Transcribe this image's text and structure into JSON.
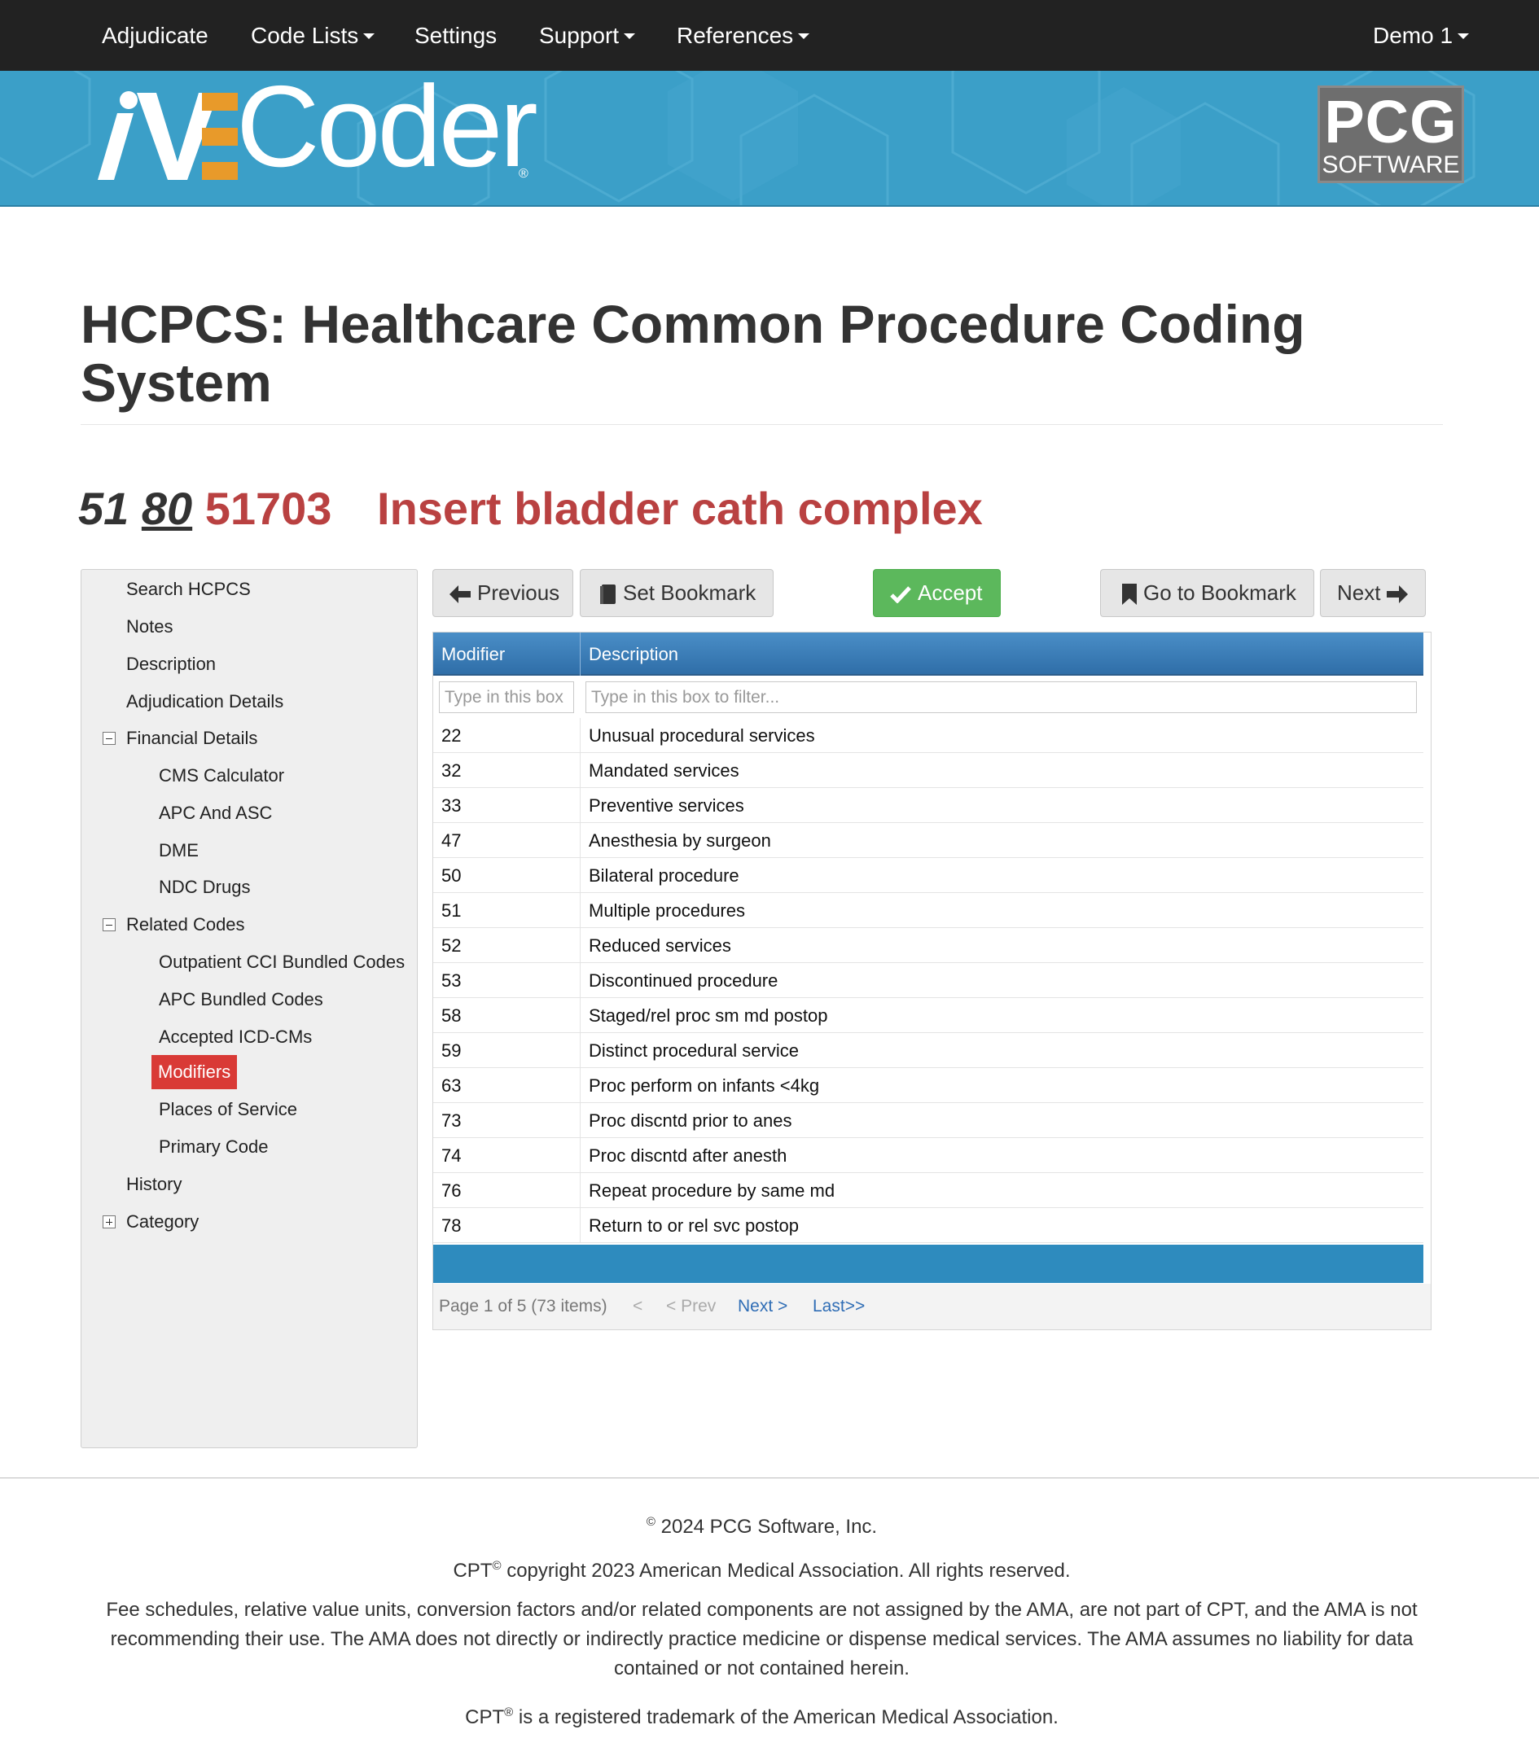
{
  "nav": {
    "adjudicate": "Adjudicate",
    "code_lists": "Code Lists",
    "settings": "Settings",
    "support": "Support",
    "references": "References",
    "user": "Demo 1"
  },
  "brand": {
    "logo_text": "Coder",
    "logo_prefix": "iVE",
    "registered": "®",
    "vendor_top": "PCG",
    "vendor_bottom": "SOFTWARE",
    "accent_color": "#e89a2a",
    "banner_color": "#3b9fc8"
  },
  "page": {
    "title": "HCPCS: Healthcare Common Procedure Coding System",
    "modifier_a": "51",
    "modifier_b": "80",
    "code": "51703",
    "code_description": "Insert bladder cath complex"
  },
  "sidebar": {
    "items": [
      {
        "label": "Search HCPCS"
      },
      {
        "label": "Notes"
      },
      {
        "label": "Description"
      },
      {
        "label": "Adjudication Details"
      },
      {
        "label": "Financial Details"
      },
      {
        "label": "CMS Calculator"
      },
      {
        "label": "APC And ASC"
      },
      {
        "label": "DME"
      },
      {
        "label": "NDC Drugs"
      },
      {
        "label": "Related Codes"
      },
      {
        "label": "Outpatient CCI Bundled Codes"
      },
      {
        "label": "APC Bundled Codes"
      },
      {
        "label": "Accepted ICD-CMs"
      },
      {
        "label": "Modifiers"
      },
      {
        "label": "Places of Service"
      },
      {
        "label": "Primary Code"
      },
      {
        "label": "History"
      },
      {
        "label": "Category"
      }
    ]
  },
  "toolbar": {
    "previous": "Previous",
    "set_bookmark": "Set Bookmark",
    "accept": "Accept",
    "go_to_bookmark": "Go to Bookmark",
    "next": "Next"
  },
  "grid": {
    "columns": [
      "Modifier",
      "Description"
    ],
    "filter_modifier_placeholder": "Type in this box",
    "filter_description_placeholder": "Type in this box to filter...",
    "rows": [
      {
        "modifier": "22",
        "description": "Unusual procedural services"
      },
      {
        "modifier": "32",
        "description": "Mandated services"
      },
      {
        "modifier": "33",
        "description": "Preventive services"
      },
      {
        "modifier": "47",
        "description": "Anesthesia by surgeon"
      },
      {
        "modifier": "50",
        "description": "Bilateral procedure"
      },
      {
        "modifier": "51",
        "description": "Multiple procedures"
      },
      {
        "modifier": "52",
        "description": "Reduced services"
      },
      {
        "modifier": "53",
        "description": "Discontinued procedure"
      },
      {
        "modifier": "58",
        "description": "Staged/rel proc sm md postop"
      },
      {
        "modifier": "59",
        "description": "Distinct procedural service"
      },
      {
        "modifier": "63",
        "description": "Proc perform on infants <4kg"
      },
      {
        "modifier": "73",
        "description": "Proc discntd prior to anes"
      },
      {
        "modifier": "74",
        "description": "Proc discntd after anesth"
      },
      {
        "modifier": "76",
        "description": "Repeat procedure by same md"
      },
      {
        "modifier": "78",
        "description": "Return to or rel svc postop"
      }
    ],
    "pager": {
      "status": "Page 1 of 5 (73 items)",
      "first": "<",
      "prev": "< Prev",
      "next": "Next >",
      "last": "Last>>"
    }
  },
  "footer": {
    "copyright_symbol": "©",
    "copyright": "2024 PCG Software, Inc.",
    "cpt_prefix": "CPT",
    "cpt_copyright_symbol": "©",
    "cpt_copyright": "copyright 2023 American Medical Association. All rights reserved.",
    "disclaimer": "Fee schedules, relative value units, conversion factors and/or related components are not assigned by the AMA, are not part of CPT, and the AMA is not recommending their use. The AMA does not directly or indirectly practice medicine or dispense medical services. The AMA assumes no liability for data contained or not contained herein.",
    "trademark_prefix": "CPT",
    "trademark_symbol": "®",
    "trademark": "is a registered trademark of the American Medical Association."
  }
}
